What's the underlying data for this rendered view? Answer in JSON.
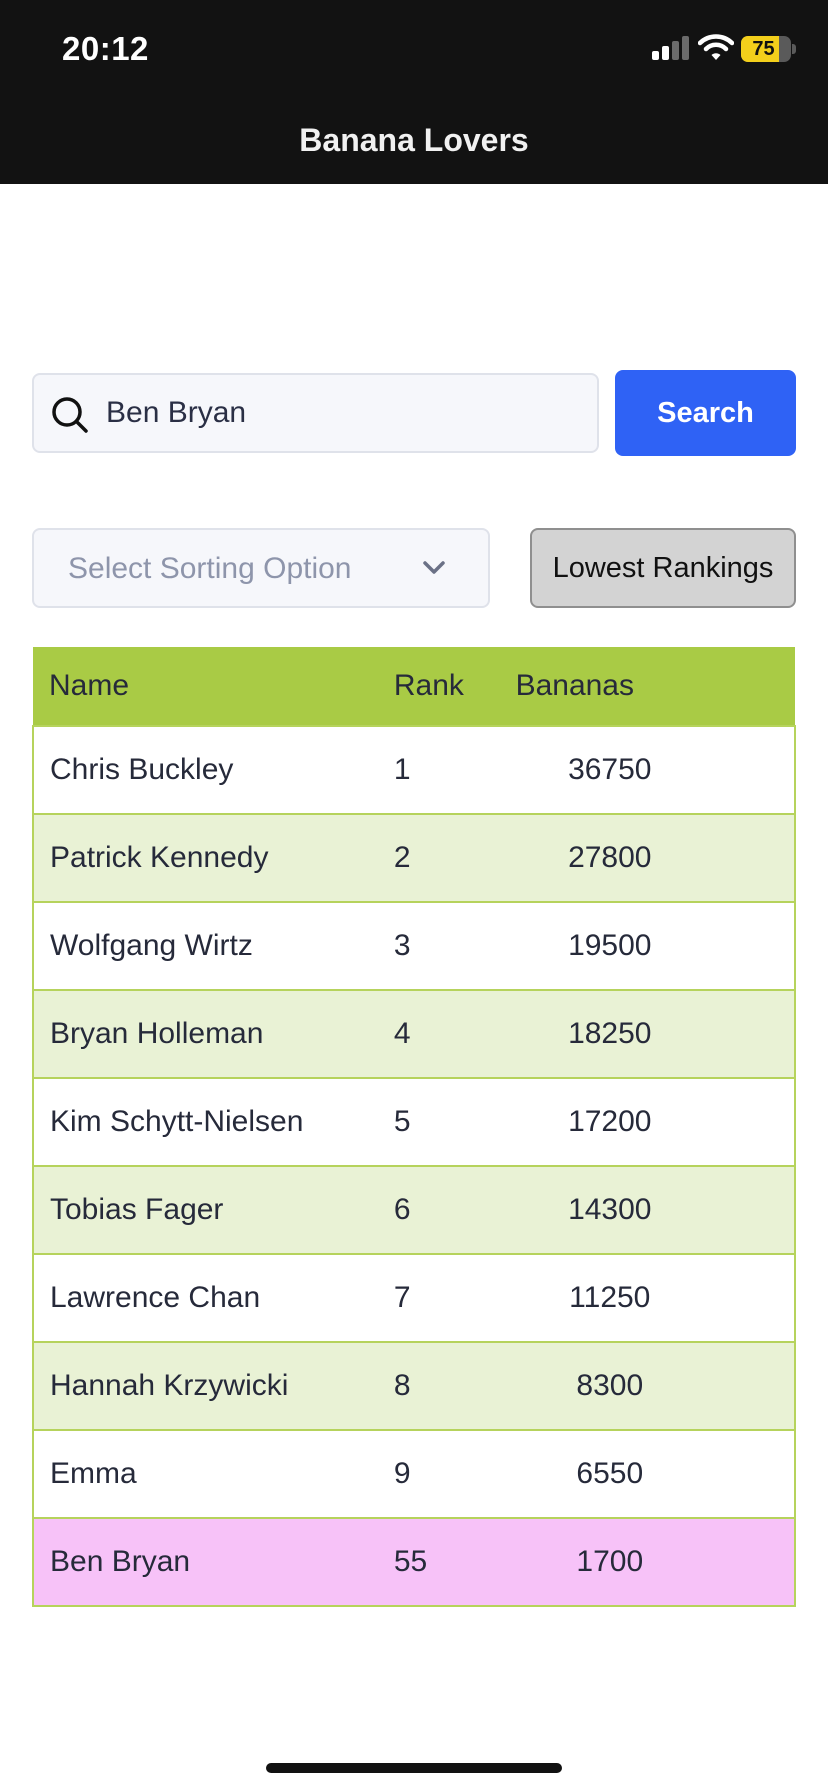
{
  "status_bar": {
    "time": "20:12",
    "battery": "75",
    "battery_level": 0.75
  },
  "header": {
    "title": "Banana Lovers"
  },
  "search": {
    "value": "Ben Bryan",
    "button_label": "Search"
  },
  "sort": {
    "placeholder": "Select Sorting Option",
    "toggle_label": "Lowest Rankings"
  },
  "table": {
    "columns": [
      "Name",
      "Rank",
      "Bananas"
    ],
    "rows": [
      {
        "name": "Chris Buckley",
        "rank": "1",
        "bananas": "36750"
      },
      {
        "name": "Patrick Kennedy",
        "rank": "2",
        "bananas": "27800"
      },
      {
        "name": "Wolfgang Wirtz",
        "rank": "3",
        "bananas": "19500"
      },
      {
        "name": "Bryan Holleman",
        "rank": "4",
        "bananas": "18250"
      },
      {
        "name": "Kim Schytt-Nielsen",
        "rank": "5",
        "bananas": "17200"
      },
      {
        "name": "Tobias Fager",
        "rank": "6",
        "bananas": "14300"
      },
      {
        "name": "Lawrence Chan",
        "rank": "7",
        "bananas": "11250"
      },
      {
        "name": "Hannah Krzywicki",
        "rank": "8",
        "bananas": "8300"
      },
      {
        "name": "Emma",
        "rank": "9",
        "bananas": "6550"
      },
      {
        "name": "Ben Bryan",
        "rank": "55",
        "bananas": "1700"
      }
    ]
  },
  "colors": {
    "header_bg": "#121212",
    "accent_blue": "#2f62f5",
    "table_header_green": "#a9cb45",
    "row_stripe_green": "#e9f2d5",
    "highlight_pink": "#f7c2f8"
  }
}
